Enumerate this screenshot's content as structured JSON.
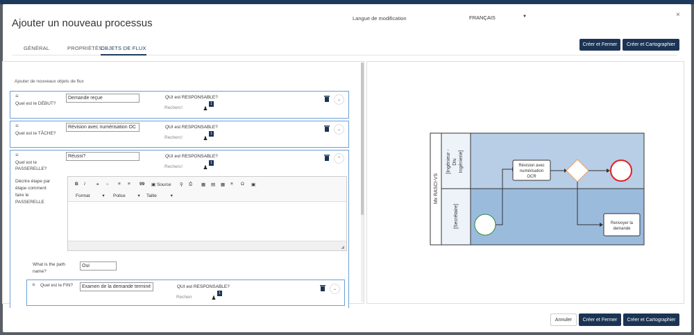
{
  "header": {
    "title": "Ajouter un nouveau processus",
    "lang_label": "Langue de modification",
    "lang_value": "FRANÇAIS",
    "close": "×"
  },
  "tabs": [
    {
      "label": "GÉNÉRAL"
    },
    {
      "label": "PROPRIÉTÉS"
    },
    {
      "label": "OBJETS DE FLUX"
    }
  ],
  "top_buttons": {
    "create_close": "Créer et Fermer",
    "create_map": "Créer et Cartographier"
  },
  "flow": {
    "section_title": "Ajouter de nouveaux objets de flux",
    "responsible_label": "QUI est RESPONSABLE?",
    "search_placeholder": "Recherc!",
    "badge": "1",
    "items": [
      {
        "question": "Quel est le DÉBUT?",
        "value": "Demande reçue"
      },
      {
        "question": "Quel est le TÂCHE?",
        "value": "Révision avec numérisation OC"
      },
      {
        "question_line1": "Quel est le",
        "question_line2": "PASSERELLE?",
        "value": "Réussi?",
        "describe": [
          "Décrire étape par",
          "étape comment",
          "faire le",
          "PASSERELLE"
        ]
      }
    ],
    "editor": {
      "bold": "B",
      "italic": "I",
      "quote": "99",
      "source": "Source",
      "omega": "Ω",
      "format": "Format",
      "font": "Police",
      "size": "Taille"
    },
    "path": {
      "label_line1": "What is the path",
      "label_line2": "name?",
      "value": "Oui"
    },
    "end": {
      "question": "Quel est le FIN?",
      "value": "Examen de la demande terminé",
      "search": "Rechen"
    }
  },
  "diagram": {
    "pool": "Mx RASCI-VS",
    "lane1": [
      "[Ingénieur -",
      "Div.",
      "Ingénierie]"
    ],
    "lane2": "[Secrétaire]",
    "task1": [
      "Révision avec",
      "numérisation",
      "OCR"
    ],
    "task2": [
      "Renvoyer la",
      "demande"
    ]
  },
  "bottom_buttons": {
    "cancel": "Annuler",
    "create_close": "Créer et Fermer",
    "create_map": "Créer et Cartographier"
  },
  "colors": {
    "primary": "#1c3454",
    "card_border": "#6a9fd4",
    "lane_top": "#b8cde6",
    "lane_bottom": "#9bbbdd",
    "end_event": "#e02020",
    "gateway": "#e3a36a"
  }
}
